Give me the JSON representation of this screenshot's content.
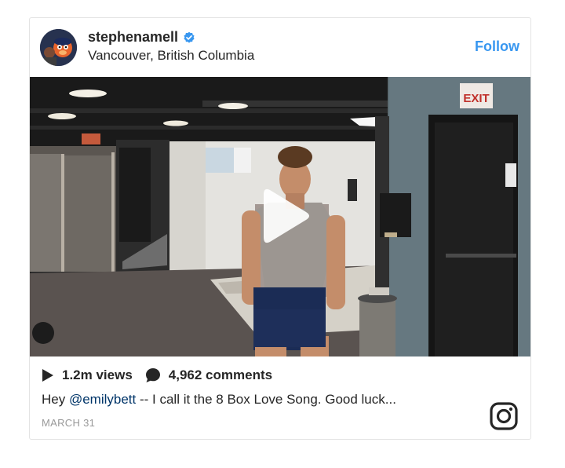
{
  "post": {
    "username": "stephenamell",
    "location": "Vancouver, British Columbia",
    "follow_label": "Follow",
    "views_label": "1.2m views",
    "comments_label": "4,962 comments",
    "caption_prefix": "Hey ",
    "caption_mention": "@emilybett",
    "caption_text": " -- I call it the 8 Box Love Song. Good luck...",
    "date": "MARCH 31",
    "exit_sign": "EXIT"
  },
  "icons": {
    "verified": "verified-badge-icon",
    "play": "play-icon",
    "comment": "comment-bubble-icon",
    "instagram": "instagram-logo-icon"
  },
  "colors": {
    "accent": "#3897f0",
    "mention": "#003569",
    "muted": "#999999",
    "text": "#262626",
    "exit_red": "#c0302a"
  }
}
